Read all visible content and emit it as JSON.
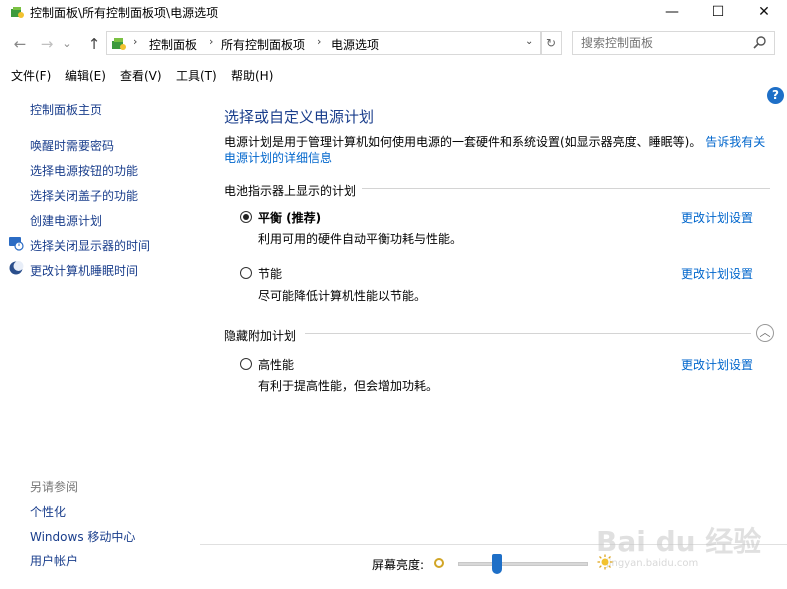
{
  "window": {
    "title": "控制面板\\所有控制面板项\\电源选项",
    "minimize": "—",
    "maximize": "☐",
    "close": "✕"
  },
  "nav": {
    "back": "←",
    "forward": "→",
    "recent": "⌄",
    "up": "↑",
    "breadcrumb": [
      "控制面板",
      "所有控制面板项",
      "电源选项"
    ],
    "search_placeholder": "搜索控制面板"
  },
  "menu": [
    "文件(F)",
    "编辑(E)",
    "查看(V)",
    "工具(T)",
    "帮助(H)"
  ],
  "sidebar": {
    "home": "控制面板主页",
    "links": [
      "唤醒时需要密码",
      "选择电源按钮的功能",
      "选择关闭盖子的功能",
      "创建电源计划",
      "选择关闭显示器的时间",
      "更改计算机睡眠时间"
    ],
    "see_also_title": "另请参阅",
    "see_also": [
      "个性化",
      "Windows 移动中心",
      "用户帐户"
    ]
  },
  "main": {
    "title": "选择或自定义电源计划",
    "intro": "电源计划是用于管理计算机如何使用电源的一套硬件和系统设置(如显示器亮度、睡眠等)。",
    "intro_link": "告诉我有关电源计划的详细信息",
    "section_battery": "电池指示器上显示的计划",
    "section_hidden": "隐藏附加计划",
    "change_label": "更改计划设置",
    "plans": [
      {
        "name": "平衡 (推荐)",
        "desc": "利用可用的硬件自动平衡功耗与性能。",
        "selected": true
      },
      {
        "name": "节能",
        "desc": "尽可能降低计算机性能以节能。",
        "selected": false
      },
      {
        "name": "高性能",
        "desc": "有利于提高性能，但会增加功耗。",
        "selected": false
      }
    ]
  },
  "brightness": {
    "label": "屏幕亮度:",
    "level": 0.3
  },
  "watermark": {
    "text": "Bai du 经验",
    "sub": "jingyan.baidu.com"
  },
  "colors": {
    "link": "#0066cc",
    "nav_link": "#1a3e8c",
    "accent": "#1e6fc7"
  }
}
